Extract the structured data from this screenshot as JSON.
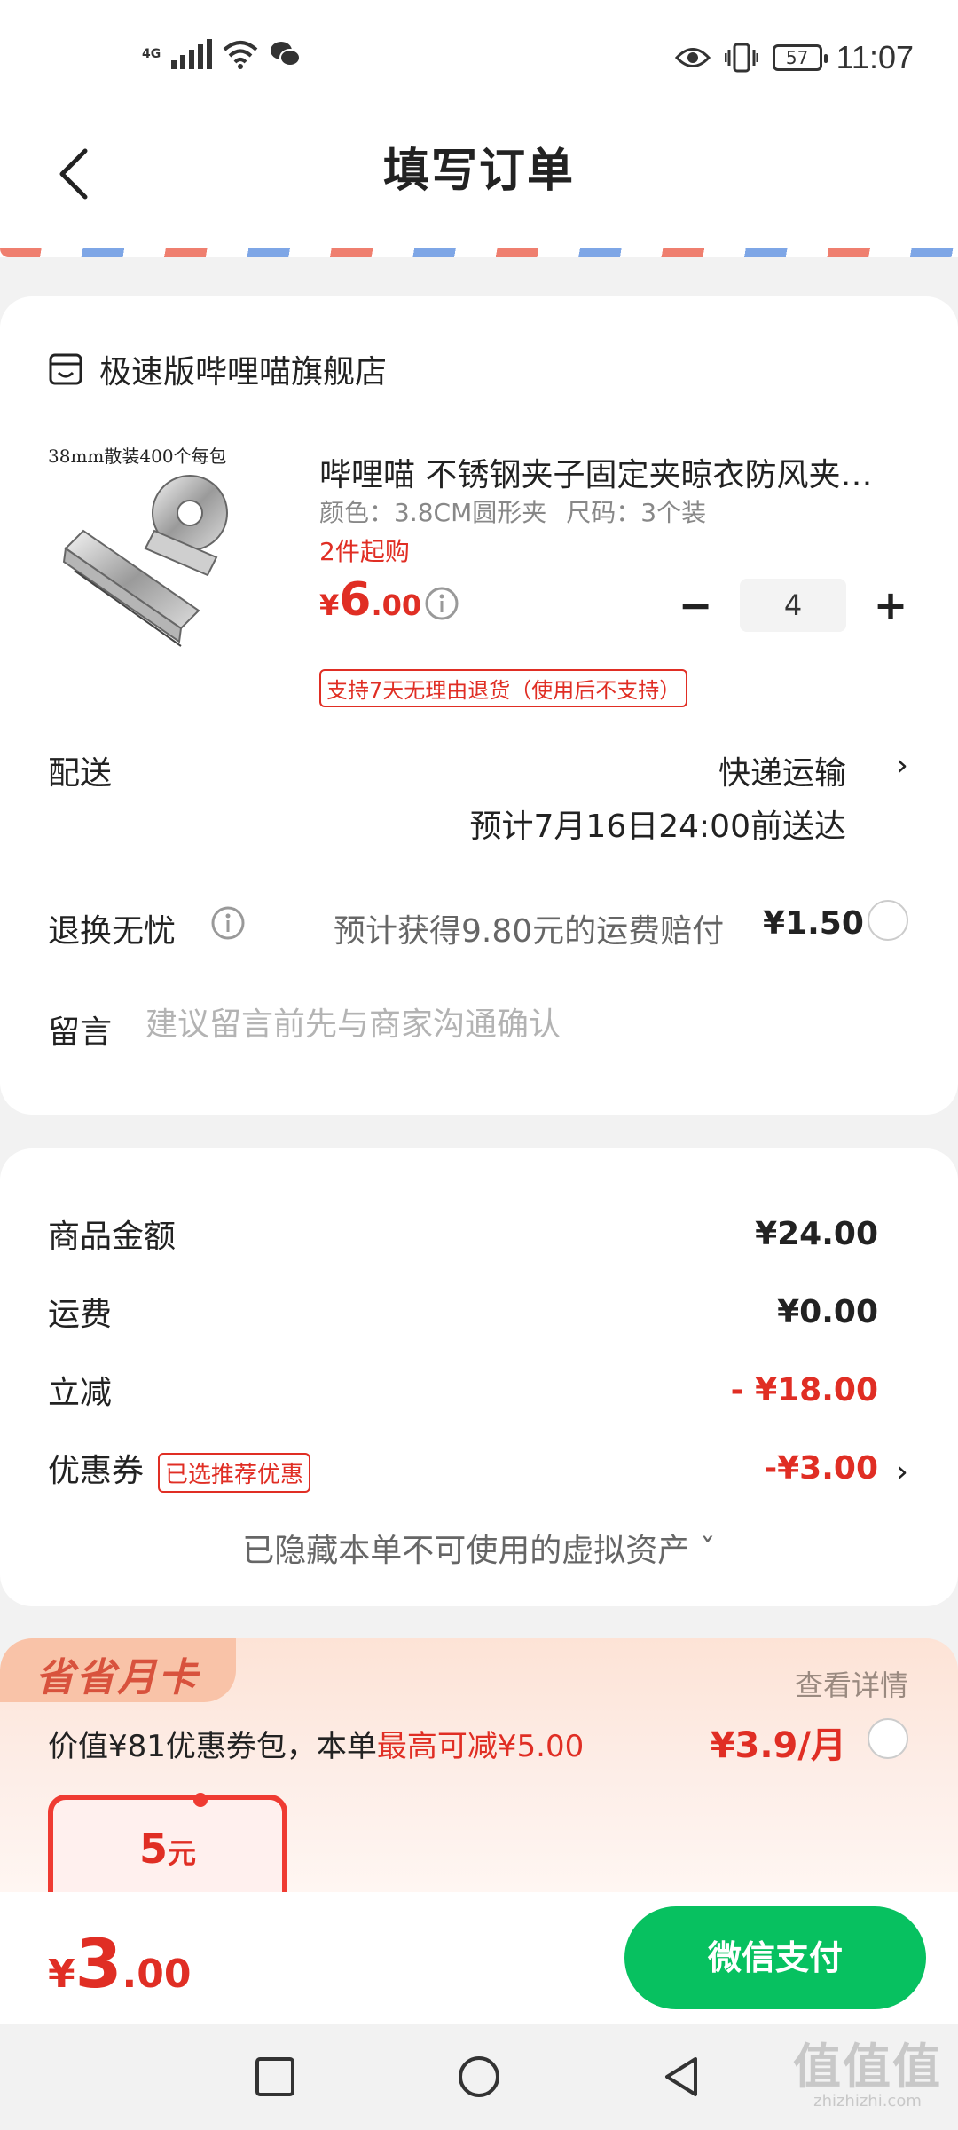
{
  "status_bar": {
    "network": "4G",
    "battery": "57",
    "time": "11:07"
  },
  "header": {
    "title": "填写订单"
  },
  "shop": {
    "name": "极速版哔哩喵旗舰店"
  },
  "product": {
    "image_label": "38mm散装400个每包",
    "title": "哔哩喵 不锈钢夹子固定夹晾衣防风夹子长尾夹",
    "spec_color": "颜色：3.8CM圆形夹",
    "spec_size": "尺码：3个装",
    "min_purchase": "2件起购",
    "price_currency": "¥",
    "price_int": "6",
    "price_dec": ".00",
    "quantity": "4",
    "minus": "−",
    "plus": "+",
    "return_policy": "支持7天无理由退货（使用后不支持）"
  },
  "delivery": {
    "label": "配送",
    "method": "快递运输",
    "arrow": "›",
    "eta": "预计7月16日24:00前送达"
  },
  "return_insurance": {
    "label": "退换无忧",
    "text": "预计获得9.80元的运费赔付",
    "price": "¥1.50"
  },
  "message": {
    "label": "留言",
    "placeholder": "建议留言前先与商家沟通确认"
  },
  "summary": {
    "goods_label": "商品金额",
    "goods_value": "¥24.00",
    "shipping_label": "运费",
    "shipping_value": "¥0.00",
    "discount_label": "立减",
    "discount_value": "- ¥18.00",
    "coupon_label": "优惠券",
    "coupon_tag": "已选推荐优惠",
    "coupon_value": "-¥3.00",
    "coupon_arrow": "›",
    "hidden_assets": "已隐藏本单不可使用的虚拟资产 ˇ"
  },
  "promo": {
    "badge": "省省月卡",
    "details": "查看详情",
    "desc_prefix": "价值¥81优惠券包，本单",
    "desc_highlight": "最高可减¥5.00",
    "price": "¥3.9/月",
    "coupon_amount": "5",
    "coupon_unit": "元"
  },
  "footer": {
    "total_currency": "¥",
    "total_int": "3",
    "total_dec": ".00",
    "pay_button": "微信支付"
  },
  "watermark": {
    "logo": "值值值",
    "url": "zhizhizhi.com"
  },
  "colors": {
    "accent_red": "#e02e24",
    "pay_green": "#07c160"
  }
}
